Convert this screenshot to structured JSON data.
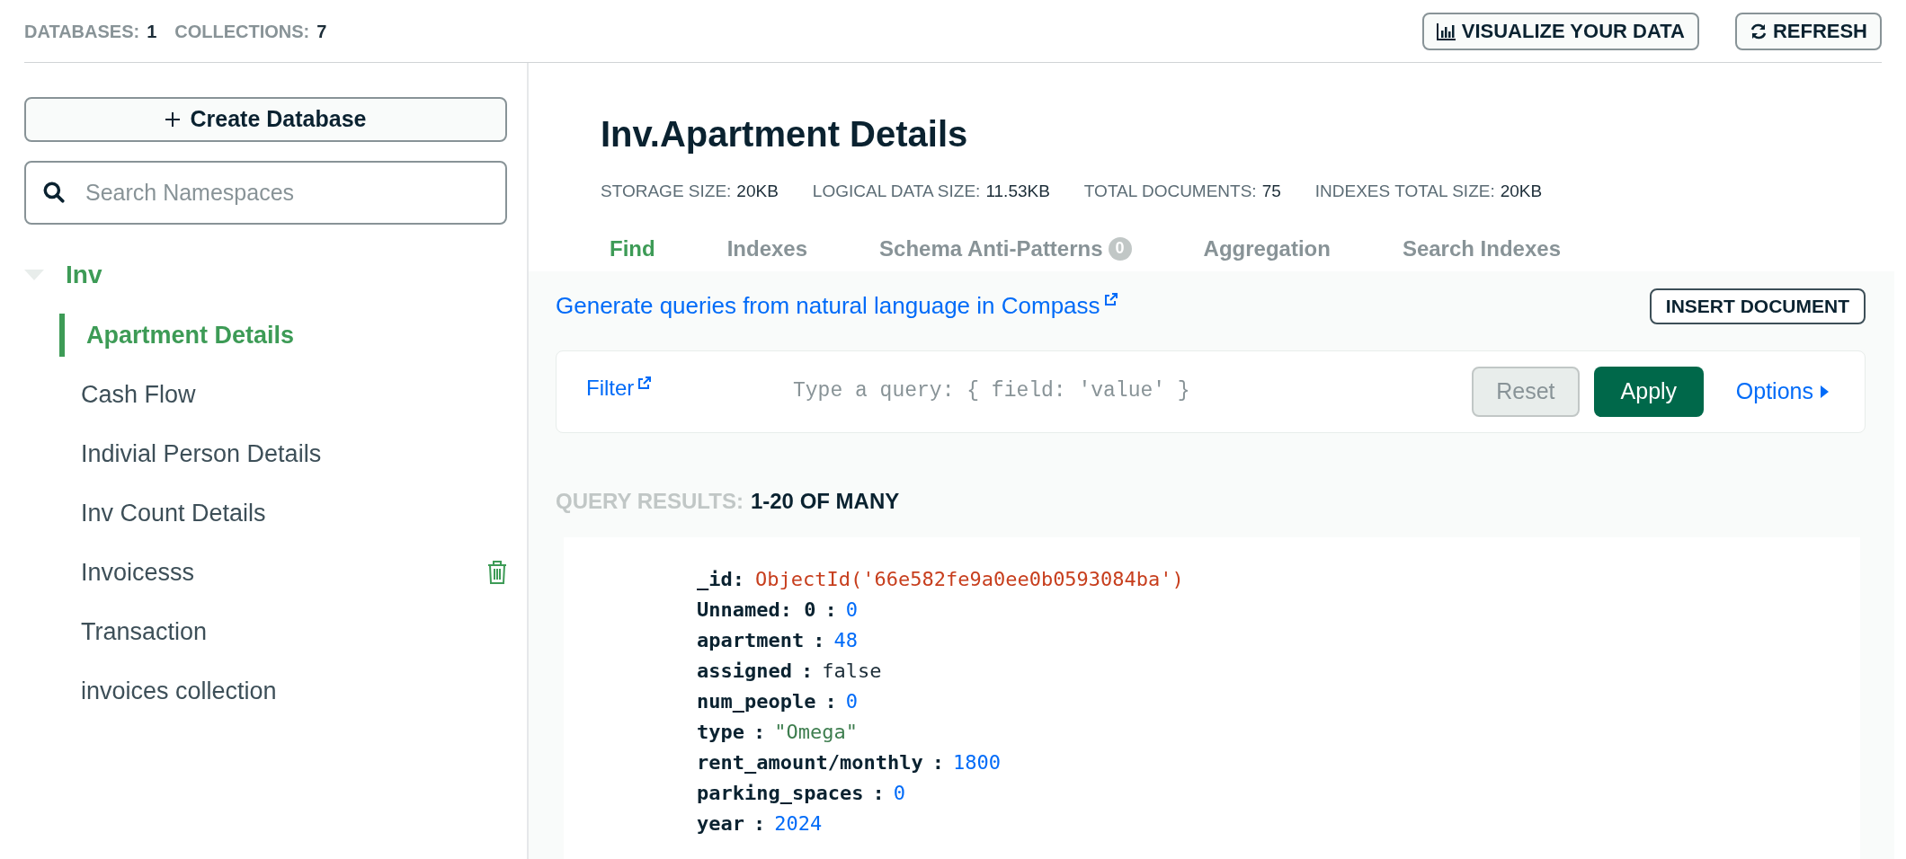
{
  "top_bar": {
    "stats": [
      {
        "label": "DATABASES:",
        "value": "1"
      },
      {
        "label": "COLLECTIONS:",
        "value": "7"
      }
    ],
    "buttons": [
      {
        "kind": "chart",
        "label": "VISUALIZE YOUR DATA"
      },
      {
        "kind": "refresh",
        "label": "REFRESH"
      }
    ]
  },
  "sidebar": {
    "create_button": "Create Database",
    "search": {
      "placeholder": "Search Namespaces"
    },
    "databases": [
      {
        "name": "Inv",
        "expanded": true,
        "children": [
          {
            "name": "Apartment Details",
            "selected": true,
            "hovered": false
          },
          {
            "name": "Cash Flow",
            "selected": false,
            "hovered": false
          },
          {
            "name": "Indivial Person Details",
            "selected": false,
            "hovered": false
          },
          {
            "name": "Inv Count Details",
            "selected": false,
            "hovered": false
          },
          {
            "name": "Invoicesss",
            "selected": false,
            "hovered": true
          },
          {
            "name": "Transaction",
            "selected": false,
            "hovered": false
          },
          {
            "name": "invoices collection",
            "selected": false,
            "hovered": false
          }
        ]
      }
    ]
  },
  "collection": {
    "title": "Inv.Apartment Details",
    "stats": [
      {
        "label": "STORAGE SIZE:",
        "value": "20KB"
      },
      {
        "label": "LOGICAL DATA SIZE:",
        "value": "11.53KB"
      },
      {
        "label": "TOTAL DOCUMENTS:",
        "value": "75"
      },
      {
        "label": "INDEXES TOTAL SIZE:",
        "value": "20KB"
      }
    ],
    "tabs": [
      {
        "label": "Find",
        "selected": true
      },
      {
        "label": "Indexes",
        "selected": false
      },
      {
        "label": "Schema Anti-Patterns",
        "badge": "0",
        "selected": false
      },
      {
        "label": "Aggregation",
        "selected": false
      },
      {
        "label": "Search Indexes",
        "selected": false
      }
    ]
  },
  "find": {
    "nl_link": "Generate queries from natural language in Compass",
    "insert_button": "INSERT DOCUMENT",
    "filter": {
      "label": "Filter",
      "placeholder": "Type a query: { field: 'value' }",
      "reset": "Reset",
      "apply": "Apply",
      "options": "Options"
    },
    "results": {
      "label": "QUERY RESULTS:",
      "range": "1-20 OF MANY"
    },
    "document": [
      {
        "key": "_id",
        "separator": ":",
        "value": "ObjectId('66e582fe9a0ee0b0593084ba')",
        "kind": "objectid"
      },
      {
        "key": "Unnamed: 0",
        "separator": ":",
        "value": "0",
        "kind": "number"
      },
      {
        "key": "apartment",
        "separator": ":",
        "value": "48",
        "kind": "number"
      },
      {
        "key": "assigned",
        "separator": ":",
        "value": "false",
        "kind": "boolean"
      },
      {
        "key": "num_people",
        "separator": ":",
        "value": "0",
        "kind": "number"
      },
      {
        "key": "type",
        "separator": ":",
        "value": "\"Omega\"",
        "kind": "string"
      },
      {
        "key": "rent_amount/monthly",
        "separator": ":",
        "value": "1800",
        "kind": "number"
      },
      {
        "key": "parking_spaces",
        "separator": ":",
        "value": "0",
        "kind": "number"
      },
      {
        "key": "year",
        "separator": ":",
        "value": "2024",
        "kind": "number"
      }
    ]
  }
}
